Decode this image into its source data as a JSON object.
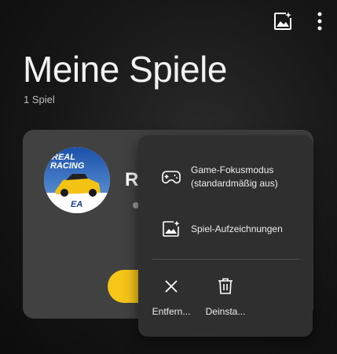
{
  "header": {
    "title": "Meine Spiele",
    "subtitle": "1 Spiel",
    "icons": [
      "gallery-icon",
      "more-vert-icon"
    ]
  },
  "game": {
    "name": "R",
    "logo_lines": [
      "REAL",
      "RACING"
    ],
    "publisher_badge": "EA"
  },
  "context_menu": {
    "items": [
      {
        "icon": "gamepad-icon",
        "label_line1": "Game-Fokusmodus",
        "label_line2": "(standardmäßig aus)"
      },
      {
        "icon": "gallery-icon",
        "label": "Spiel-Aufzeichnungen"
      }
    ],
    "actions": [
      {
        "icon": "close-icon",
        "label": "Entfern..."
      },
      {
        "icon": "trash-icon",
        "label": "Deinsta..."
      }
    ]
  },
  "colors": {
    "accent": "#f5c518",
    "card": "#414141",
    "menu": "#2f2f2f"
  }
}
